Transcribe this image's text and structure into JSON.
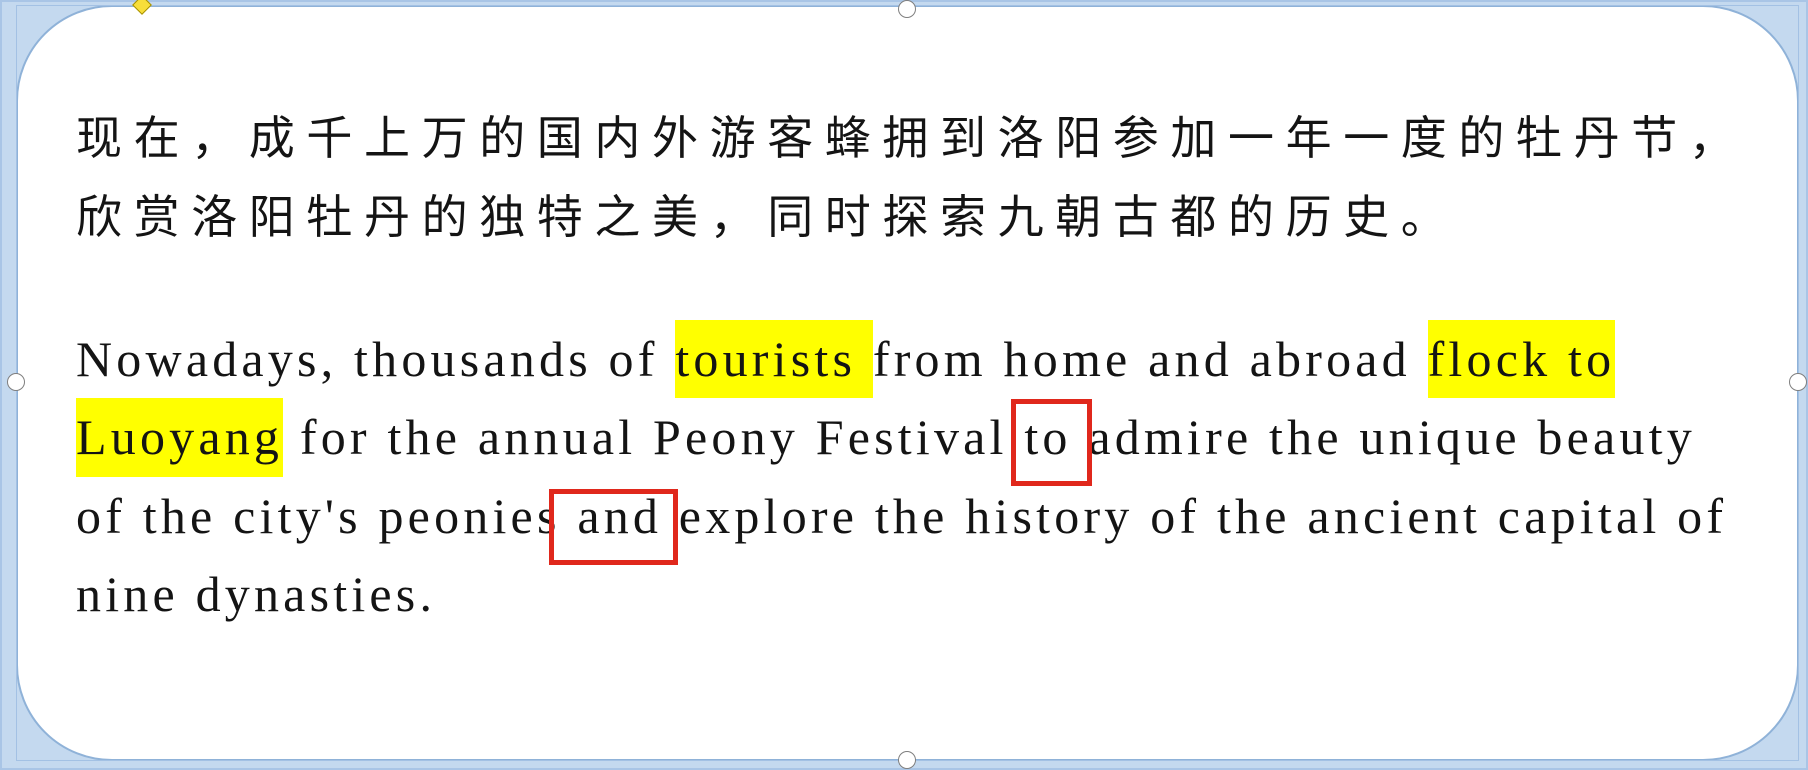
{
  "slide": {
    "colors": {
      "background": "#c4d9ef",
      "shape_fill": "#ffffff",
      "shape_outline": "#8fb2d8",
      "text": "#141414",
      "highlight": "#ffff00",
      "annotation_box": "#e0281c",
      "adjustment_handle": "#f8de3a"
    },
    "shape": {
      "selected": true
    },
    "chinese_paragraph": {
      "lines": [
        "现在，成千上万的国内外游客蜂拥到洛阳参加一年一度的牡丹节，",
        "欣赏洛阳牡丹的独特之美，同时探索九朝古都的历史。"
      ]
    },
    "english_paragraph": {
      "lines": [
        [
          {
            "text": "Nowadays, thousands of "
          },
          {
            "text": "tourists ",
            "highlight": true
          },
          {
            "text": "from home and abroad "
          },
          {
            "text": "flock to",
            "highlight": true
          }
        ],
        [
          {
            "text": "Luoyang",
            "highlight": true
          },
          {
            "text": " for the annual Peony Festival "
          },
          {
            "text": "to",
            "boxed": true
          },
          {
            "text": " admire the unique beauty"
          }
        ],
        [
          {
            "text": "of the city's peonies "
          },
          {
            "text": "and",
            "boxed": true
          },
          {
            "text": " explore the history of the ancient capital of"
          }
        ],
        [
          {
            "text": "nine dynasties."
          }
        ]
      ]
    }
  },
  "selection_handles": {
    "adjustment_icon": "yellow-diamond-icon",
    "resize_icon": "circle-handle-icon"
  }
}
